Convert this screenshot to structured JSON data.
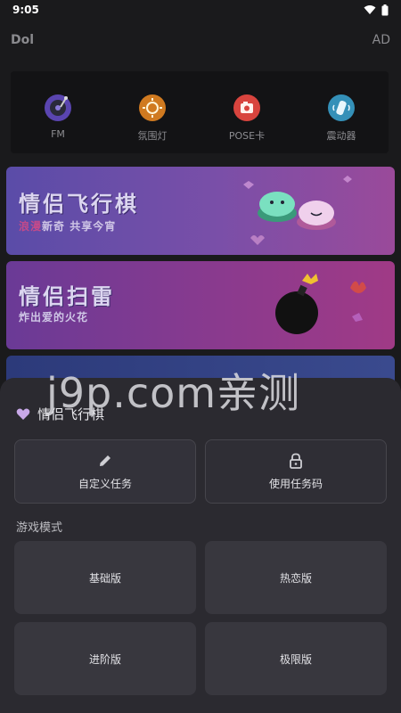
{
  "status": {
    "time": "9:05"
  },
  "header": {
    "app_name": "Dol",
    "ad_label": "AD"
  },
  "tools": [
    {
      "label": "FM",
      "icon": "turntable-icon",
      "color": "#6a4bc4"
    },
    {
      "label": "氛围灯",
      "icon": "atmosphere-light-icon",
      "color": "#e08a2a"
    },
    {
      "label": "POSE卡",
      "icon": "camera-icon",
      "color": "#e0504a"
    },
    {
      "label": "震动器",
      "icon": "vibrator-icon",
      "color": "#3aa0c8"
    }
  ],
  "banners": [
    {
      "title": "情侣飞行棋",
      "subtitle_highlight": "浪漫",
      "subtitle_rest": "新奇 共享今宵"
    },
    {
      "title": "情侣扫雷",
      "subtitle": "炸出爱的火花"
    }
  ],
  "sheet": {
    "title": "情侣飞行棋",
    "custom_task_label": "自定义任务",
    "use_code_label": "使用任务码",
    "mode_section_label": "游戏模式",
    "modes": [
      "基础版",
      "热恋版",
      "进阶版",
      "极限版"
    ]
  },
  "watermark": "j9p.com亲测",
  "colors": {
    "heart": "#c8a8e8",
    "sheet_bg": "#2b2a30"
  }
}
